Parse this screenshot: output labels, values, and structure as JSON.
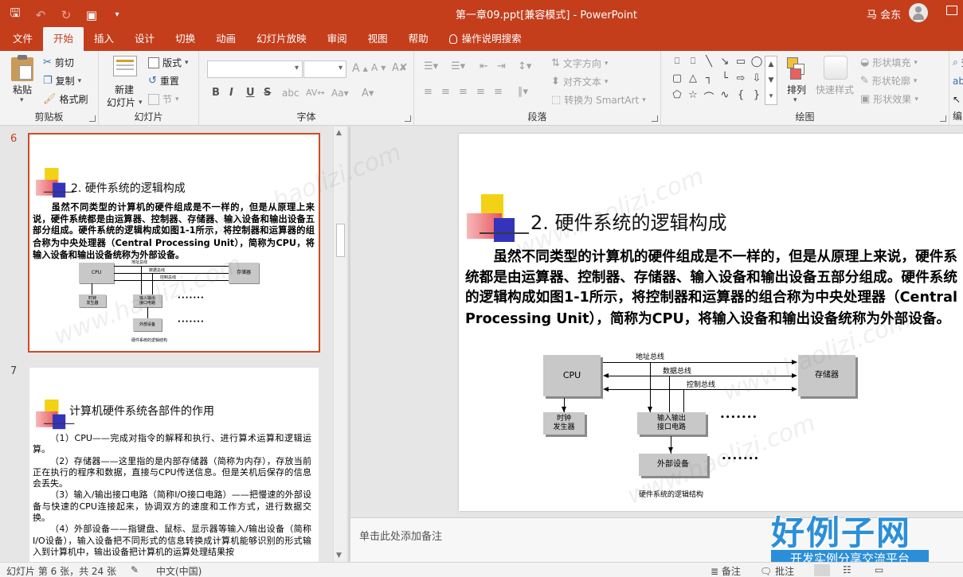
{
  "window": {
    "title": "第一章09.ppt[兼容模式] - PowerPoint",
    "user": "马 会东"
  },
  "tabs": [
    "文件",
    "开始",
    "插入",
    "设计",
    "切换",
    "动画",
    "幻灯片放映",
    "审阅",
    "视图",
    "帮助",
    "操作说明搜索"
  ],
  "active_tab": "开始",
  "ribbon": {
    "clipboard": {
      "paste": "粘贴",
      "cut": "剪切",
      "copy": "复制",
      "format_painter": "格式刷",
      "label": "剪贴板"
    },
    "slides": {
      "new_slide_1": "新建",
      "new_slide_2": "幻灯片",
      "layout": "版式",
      "reset": "重置",
      "section": "节",
      "label": "幻灯片"
    },
    "font": {
      "label": "字体",
      "buttons": [
        "B",
        "I",
        "U",
        "S"
      ]
    },
    "paragraph": {
      "text_direction": "文字方向",
      "align_text": "对齐文本",
      "convert_smartart": "转换为 SmartArt",
      "label": "段落"
    },
    "drawing": {
      "arrange": "排列",
      "quick_styles": "快速样式",
      "shape_fill": "形状填充",
      "shape_outline": "形状轮廓",
      "shape_effects": "形状效果",
      "label": "绘图"
    },
    "editing": {
      "find": "查",
      "replace": "替",
      "select": "选",
      "label": "编"
    }
  },
  "thumbnails": [
    {
      "number": "6",
      "title": "2. 硬件系统的逻辑构成",
      "selected": true
    },
    {
      "number": "7",
      "title": "计算机硬件系统各部件的作用",
      "selected": false
    }
  ],
  "slide": {
    "title": "2. 硬件系统的逻辑构成",
    "body_parts": [
      "虽然不同类型的计算机的硬件组成是不一样的，但是从原理上来说，硬件系统都是由运算器、控制器、存储器、输入设备和输出设备五部分组成。硬件系统的逻辑构成如图",
      "1-1",
      "所示，将控制器和运算器的组合称为中央处理器（",
      "Central Processing Unit",
      "），简称为",
      "CPU",
      "，将输入设备和输出设备统称为外部设备。"
    ],
    "diagram": {
      "cpu": "CPU",
      "memory": "存储器",
      "clock_1": "时钟",
      "clock_2": "发生器",
      "io_1": "输入输出",
      "io_2": "接口电路",
      "peripheral": "外部设备",
      "address_bus": "地址总线",
      "data_bus": "数据总线",
      "control_bus": "控制总线",
      "dots": "•••••••",
      "caption": "硬件系统的逻辑结构"
    }
  },
  "slide7": {
    "items": [
      "（1）CPU——完成对指令的解释和执行、进行算术运算和逻辑运算。",
      "（2）存储器——这里指的是内部存储器（简称为内存），存放当前正在执行的程序和数据，直接与CPU传送信息。但是关机后保存的信息会丢失。",
      "（3）输入/输出接口电路（简称I/O接口电路）——把慢速的外部设备与快速的CPU连接起来，协调双方的速度和工作方式，进行数据交换。",
      "（4）外部设备——指键盘、鼠标、显示器等输入/输出设备（简称I/O设备），输入设备把不同形式的信息转换成计算机能够识别的形式输入到计算机中，输出设备把计算机的运算处理结果按"
    ]
  },
  "notes_placeholder": "单击此处添加备注",
  "status": {
    "slide_info": "幻灯片 第 6 张，共 24 张",
    "language": "中文(中国)",
    "notes": "备注",
    "comments": "批注"
  },
  "watermark": {
    "url": "www.haolizi.com",
    "logo_main": "好例子网",
    "logo_sub": "开发实例分享交流平台"
  }
}
